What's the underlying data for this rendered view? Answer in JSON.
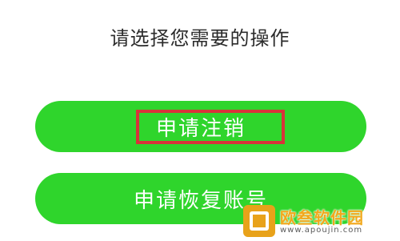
{
  "prompt": {
    "title": "请选择您需要的操作"
  },
  "actions": {
    "cancel_account_label": "申请注销",
    "restore_account_label": "申请恢复账号"
  },
  "colors": {
    "button_green": "#2fd52c",
    "highlight_red": "#d8333a",
    "watermark_orange": "#f2a81c"
  },
  "watermark": {
    "name": "欧叁软件园",
    "url": "www.apoujin.com"
  }
}
